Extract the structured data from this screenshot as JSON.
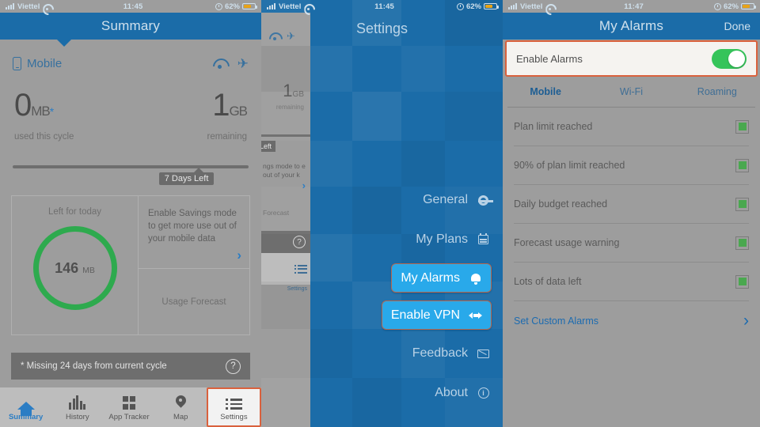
{
  "status_bar": {
    "carrier": "Viettel",
    "time_left": "11:45",
    "time_right": "11:47",
    "battery_percent": "62%"
  },
  "summary_panel": {
    "nav_title": "Summary",
    "connection_label": "Mobile",
    "used_value": "0",
    "used_unit": "MB",
    "used_asterisk": "*",
    "used_caption": "used this cycle",
    "remaining_value": "1",
    "remaining_unit": "GB",
    "remaining_caption": "remaining",
    "days_left_badge": "7 Days Left",
    "left_for_today_title": "Left for today",
    "ring_value": "146",
    "ring_unit": "MB",
    "savings_text": "Enable Savings mode to get more use out of  your mobile data",
    "usage_forecast_label": "Usage Forecast",
    "missing_note": "* Missing 24 days from current cycle",
    "help_glyph": "?",
    "chevron_glyph": "›",
    "tabs": [
      {
        "label": "Summary",
        "icon": "home-icon",
        "active": true,
        "highlighted": false
      },
      {
        "label": "History",
        "icon": "bar-chart-icon",
        "active": false,
        "highlighted": false
      },
      {
        "label": "App Tracker",
        "icon": "grid-icon",
        "active": false,
        "highlighted": false
      },
      {
        "label": "Map",
        "icon": "map-pin-icon",
        "active": false,
        "highlighted": false
      },
      {
        "label": "Settings",
        "icon": "list-icon",
        "active": false,
        "highlighted": true
      }
    ]
  },
  "settings_panel": {
    "nav_title": "Settings",
    "menu": [
      {
        "label": "General",
        "icon": "gear-icon",
        "highlighted": false
      },
      {
        "label": "My Plans",
        "icon": "calendar-icon",
        "highlighted": false
      },
      {
        "label": "My Alarms",
        "icon": "bell-icon",
        "highlighted": true
      },
      {
        "label": "Enable VPN",
        "icon": "vpn-icon",
        "highlighted": true
      },
      {
        "label": "Feedback",
        "icon": "mail-icon",
        "highlighted": false
      },
      {
        "label": "About",
        "icon": "info-icon",
        "highlighted": false
      }
    ],
    "ghost": {
      "remaining_value": "1",
      "remaining_unit": "GB",
      "remaining_caption": "remaining",
      "days_badge": "s Left",
      "savings_text": "ngs mode to e out of  your k",
      "forecast_label": "Forecast",
      "settings_label": "Settings",
      "chevron_glyph": "›",
      "help_glyph": "?"
    },
    "accent_color": "#29a9ea",
    "highlight_border_color": "#b5674f"
  },
  "alarms_panel": {
    "nav_title": "My Alarms",
    "done_label": "Done",
    "enable_alarms_label": "Enable Alarms",
    "enable_alarms_on": true,
    "tabs": [
      {
        "label": "Mobile",
        "active": true
      },
      {
        "label": "Wi-Fi",
        "active": false
      },
      {
        "label": "Roaming",
        "active": false
      }
    ],
    "alarm_rows": [
      {
        "label": "Plan limit reached",
        "checked": true
      },
      {
        "label": "90% of plan limit reached",
        "checked": true
      },
      {
        "label": "Daily budget reached",
        "checked": true
      },
      {
        "label": "Forecast usage warning",
        "checked": true
      },
      {
        "label": "Lots of data left",
        "checked": true
      }
    ],
    "custom_alarms_label": "Set Custom Alarms",
    "custom_alarms_chevron": "›",
    "toggle_on_color": "#35c45a",
    "checkbox_fill_color": "#4aa84f",
    "highlight_border_color": "#d9613d"
  }
}
